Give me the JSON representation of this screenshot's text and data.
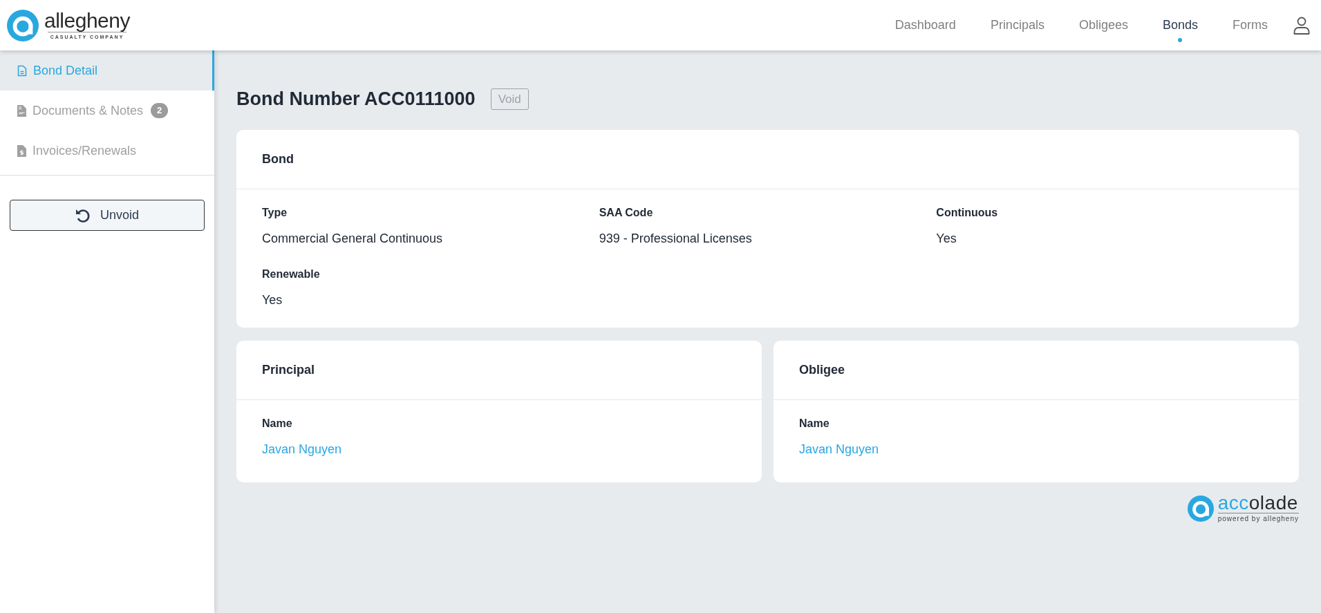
{
  "brand": {
    "name": "allegheny",
    "subtitle": "CASUALTY COMPANY"
  },
  "nav": [
    {
      "label": "Dashboard",
      "selected": false
    },
    {
      "label": "Principals",
      "selected": false
    },
    {
      "label": "Obligees",
      "selected": false
    },
    {
      "label": "Bonds",
      "selected": true
    },
    {
      "label": "Forms",
      "selected": false
    }
  ],
  "sidebar": {
    "items": [
      {
        "label": "Bond Detail",
        "kind": "document",
        "selected": true
      },
      {
        "label": "Documents & Notes",
        "kind": "signed",
        "badge": "2",
        "selected": false
      },
      {
        "label": "Invoices/Renewals",
        "kind": "invoice",
        "selected": false
      }
    ],
    "action": "Unvoid"
  },
  "page": {
    "title": "Bond Number ACC0111000",
    "status": "Void"
  },
  "bond_card": {
    "title": "Bond",
    "fields": [
      {
        "label": "Type",
        "value": "Commercial General Continuous"
      },
      {
        "label": "SAA Code",
        "value": "939 - Professional Licenses"
      },
      {
        "label": "Continuous",
        "value": "Yes"
      },
      {
        "label": "Renewable",
        "value": "Yes"
      }
    ]
  },
  "party_cards": [
    {
      "title": "Principal",
      "label": "Name",
      "value": "Javan Nguyen"
    },
    {
      "title": "Obligee",
      "label": "Name",
      "value": "Javan Nguyen"
    }
  ],
  "footer_logo": {
    "accent": "acc",
    "rest": "olade",
    "tagline": "powered by allegheny"
  }
}
